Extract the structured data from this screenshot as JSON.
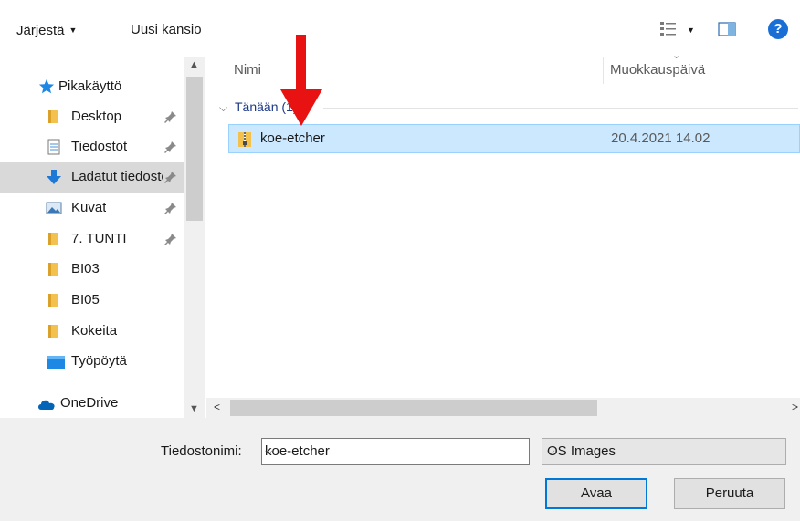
{
  "toolbar": {
    "organize_label": "Järjestä",
    "new_folder_label": "Uusi kansio",
    "help_label": "?"
  },
  "nav": {
    "items": [
      {
        "label": "Pikakäyttö",
        "icon": "star-icon"
      },
      {
        "label": "Desktop",
        "icon": "folder-icon"
      },
      {
        "label": "Tiedostot",
        "icon": "documents-icon"
      },
      {
        "label": "Ladatut tiedostot",
        "icon": "download-arrow-icon"
      },
      {
        "label": "Kuvat",
        "icon": "pictures-icon"
      },
      {
        "label": "7. TUNTI",
        "icon": "folder-icon"
      },
      {
        "label": "BI03",
        "icon": "folder-icon"
      },
      {
        "label": "BI05",
        "icon": "folder-icon"
      },
      {
        "label": "Kokeita",
        "icon": "folder-icon"
      },
      {
        "label": "Työpöytä",
        "icon": "desktop-icon"
      },
      {
        "label": "OneDrive",
        "icon": "cloud-icon"
      }
    ]
  },
  "list": {
    "columns": {
      "name": "Nimi",
      "date": "Muokkauspäivä"
    },
    "group": "Tänään (1)",
    "files": [
      {
        "name": "koe-etcher",
        "date": "20.4.2021 14.02",
        "icon": "zip-folder-icon"
      }
    ]
  },
  "bottom": {
    "filename_label": "Tiedostonimi:",
    "filename_value": "koe-etcher",
    "filter_value": "OS Images",
    "open_label": "Avaa",
    "cancel_label": "Peruuta"
  },
  "colors": {
    "selection": "#cce8ff",
    "accent": "#0078d7",
    "annotation": "#e81212"
  }
}
